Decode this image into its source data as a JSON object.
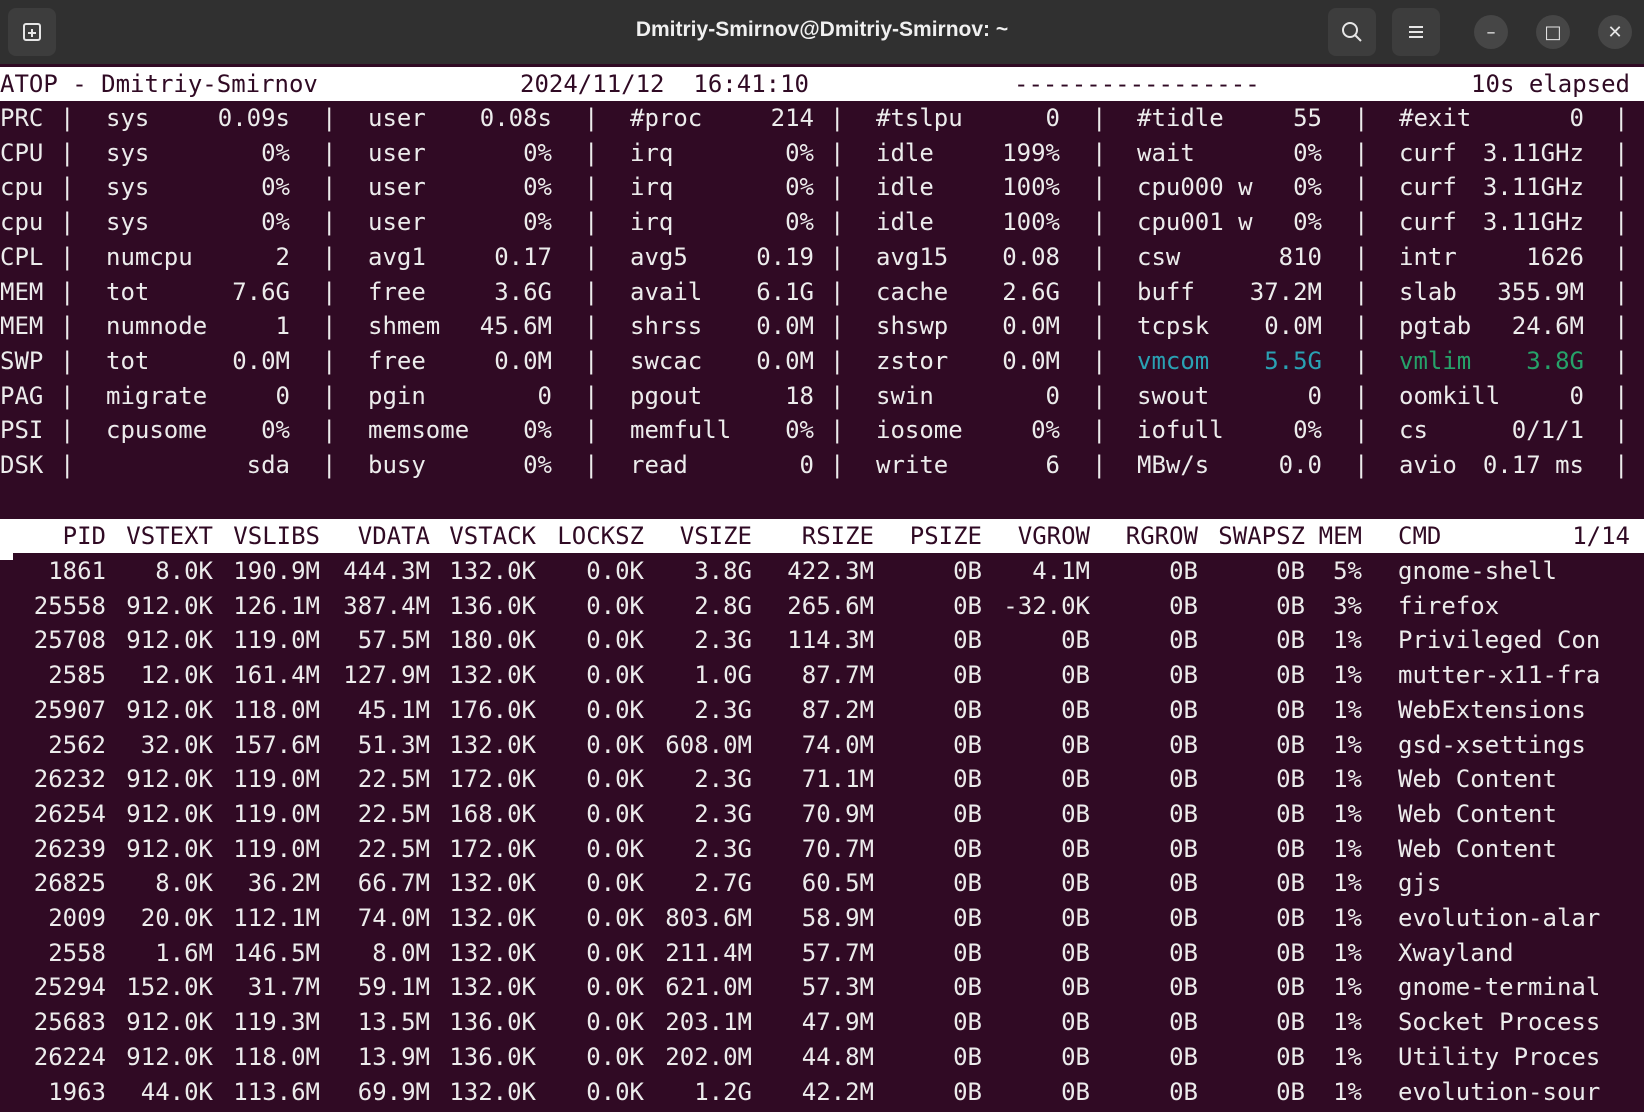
{
  "window": {
    "title": "Dmitriy-Smirnov@Dmitriy-Smirnov: ~",
    "buttons": {
      "minimize": "–",
      "maximize": "□",
      "close": "✕"
    }
  },
  "atop": {
    "header": {
      "program": "ATOP - Dmitriy-Smirnov",
      "datetime": "2024/11/12  16:41:10",
      "flags": "-----------------",
      "elapsed": "10s elapsed"
    },
    "sys_rows": [
      {
        "label": "PRC",
        "cells": [
          [
            "sys",
            "0.09s"
          ],
          [
            "user",
            "0.08s"
          ],
          [
            "#proc",
            "214"
          ],
          [
            "#tslpu",
            "0"
          ],
          [
            "#tidle",
            "55"
          ],
          [
            "#exit",
            "0"
          ]
        ]
      },
      {
        "label": "CPU",
        "cells": [
          [
            "sys",
            "0%"
          ],
          [
            "user",
            "0%"
          ],
          [
            "irq",
            "0%"
          ],
          [
            "idle",
            "199%"
          ],
          [
            "wait",
            "0%"
          ],
          [
            "curf",
            "3.11GHz"
          ]
        ]
      },
      {
        "label": "cpu",
        "cells": [
          [
            "sys",
            "0%"
          ],
          [
            "user",
            "0%"
          ],
          [
            "irq",
            "0%"
          ],
          [
            "idle",
            "100%"
          ],
          [
            "cpu000 w",
            "0%"
          ],
          [
            "curf",
            "3.11GHz"
          ]
        ]
      },
      {
        "label": "cpu",
        "cells": [
          [
            "sys",
            "0%"
          ],
          [
            "user",
            "0%"
          ],
          [
            "irq",
            "0%"
          ],
          [
            "idle",
            "100%"
          ],
          [
            "cpu001 w",
            "0%"
          ],
          [
            "curf",
            "3.11GHz"
          ]
        ]
      },
      {
        "label": "CPL",
        "cells": [
          [
            "numcpu",
            "2"
          ],
          [
            "avg1",
            "0.17"
          ],
          [
            "avg5",
            "0.19"
          ],
          [
            "avg15",
            "0.08"
          ],
          [
            "csw",
            "810"
          ],
          [
            "intr",
            "1626"
          ]
        ]
      },
      {
        "label": "MEM",
        "cells": [
          [
            "tot",
            "7.6G"
          ],
          [
            "free",
            "3.6G"
          ],
          [
            "avail",
            "6.1G"
          ],
          [
            "cache",
            "2.6G"
          ],
          [
            "buff",
            "37.2M"
          ],
          [
            "slab",
            "355.9M"
          ]
        ]
      },
      {
        "label": "MEM",
        "cells": [
          [
            "numnode",
            "1"
          ],
          [
            "shmem",
            "45.6M"
          ],
          [
            "shrss",
            "0.0M"
          ],
          [
            "shswp",
            "0.0M"
          ],
          [
            "tcpsk",
            "0.0M"
          ],
          [
            "pgtab",
            "24.6M"
          ]
        ]
      },
      {
        "label": "SWP",
        "cells": [
          [
            "tot",
            "0.0M"
          ],
          [
            "free",
            "0.0M"
          ],
          [
            "swcac",
            "0.0M"
          ],
          [
            "zstor",
            "0.0M"
          ],
          [
            "vmcom",
            "5.5G"
          ],
          [
            "vmlim",
            "3.8G"
          ]
        ]
      },
      {
        "label": "PAG",
        "cells": [
          [
            "migrate",
            "0"
          ],
          [
            "pgin",
            "0"
          ],
          [
            "pgout",
            "18"
          ],
          [
            "swin",
            "0"
          ],
          [
            "swout",
            "0"
          ],
          [
            "oomkill",
            "0"
          ]
        ]
      },
      {
        "label": "PSI",
        "cells": [
          [
            "cpusome",
            "0%"
          ],
          [
            "memsome",
            "0%"
          ],
          [
            "memfull",
            "0%"
          ],
          [
            "iosome",
            "0%"
          ],
          [
            "iofull",
            "0%"
          ],
          [
            "cs",
            "0/1/1"
          ]
        ]
      },
      {
        "label": "DSK",
        "cells": [
          [
            "",
            "sda"
          ],
          [
            "busy",
            "0%"
          ],
          [
            "read",
            "0"
          ],
          [
            "write",
            "6"
          ],
          [
            "MBw/s",
            "0.0"
          ],
          [
            "avio",
            "0.17 ms"
          ]
        ]
      }
    ],
    "highlight_colors": {
      "vmcom": "#2aa1b3",
      "vmlim": "#26a269"
    },
    "columns": [
      "PID",
      "VSTEXT",
      "VSLIBS",
      "VDATA",
      "VSTACK",
      "LOCKSZ",
      "VSIZE",
      "RSIZE",
      "PSIZE",
      "VGROW",
      "RGROW",
      "SWAPSZ",
      "MEM",
      "CMD"
    ],
    "page": "1/14",
    "processes": [
      [
        "1861",
        "8.0K",
        "190.9M",
        "444.3M",
        "132.0K",
        "0.0K",
        "3.8G",
        "422.3M",
        "0B",
        "4.1M",
        "0B",
        "0B",
        "5%",
        "gnome-shell"
      ],
      [
        "25558",
        "912.0K",
        "126.1M",
        "387.4M",
        "136.0K",
        "0.0K",
        "2.8G",
        "265.6M",
        "0B",
        "-32.0K",
        "0B",
        "0B",
        "3%",
        "firefox"
      ],
      [
        "25708",
        "912.0K",
        "119.0M",
        "57.5M",
        "180.0K",
        "0.0K",
        "2.3G",
        "114.3M",
        "0B",
        "0B",
        "0B",
        "0B",
        "1%",
        "Privileged Con"
      ],
      [
        "2585",
        "12.0K",
        "161.4M",
        "127.9M",
        "132.0K",
        "0.0K",
        "1.0G",
        "87.7M",
        "0B",
        "0B",
        "0B",
        "0B",
        "1%",
        "mutter-x11-fra"
      ],
      [
        "25907",
        "912.0K",
        "118.0M",
        "45.1M",
        "176.0K",
        "0.0K",
        "2.3G",
        "87.2M",
        "0B",
        "0B",
        "0B",
        "0B",
        "1%",
        "WebExtensions"
      ],
      [
        "2562",
        "32.0K",
        "157.6M",
        "51.3M",
        "132.0K",
        "0.0K",
        "608.0M",
        "74.0M",
        "0B",
        "0B",
        "0B",
        "0B",
        "1%",
        "gsd-xsettings"
      ],
      [
        "26232",
        "912.0K",
        "119.0M",
        "22.5M",
        "172.0K",
        "0.0K",
        "2.3G",
        "71.1M",
        "0B",
        "0B",
        "0B",
        "0B",
        "1%",
        "Web Content"
      ],
      [
        "26254",
        "912.0K",
        "119.0M",
        "22.5M",
        "168.0K",
        "0.0K",
        "2.3G",
        "70.9M",
        "0B",
        "0B",
        "0B",
        "0B",
        "1%",
        "Web Content"
      ],
      [
        "26239",
        "912.0K",
        "119.0M",
        "22.5M",
        "172.0K",
        "0.0K",
        "2.3G",
        "70.7M",
        "0B",
        "0B",
        "0B",
        "0B",
        "1%",
        "Web Content"
      ],
      [
        "26825",
        "8.0K",
        "36.2M",
        "66.7M",
        "132.0K",
        "0.0K",
        "2.7G",
        "60.5M",
        "0B",
        "0B",
        "0B",
        "0B",
        "1%",
        "gjs"
      ],
      [
        "2009",
        "20.0K",
        "112.1M",
        "74.0M",
        "132.0K",
        "0.0K",
        "803.6M",
        "58.9M",
        "0B",
        "0B",
        "0B",
        "0B",
        "1%",
        "evolution-alar"
      ],
      [
        "2558",
        "1.6M",
        "146.5M",
        "8.0M",
        "132.0K",
        "0.0K",
        "211.4M",
        "57.7M",
        "0B",
        "0B",
        "0B",
        "0B",
        "1%",
        "Xwayland"
      ],
      [
        "25294",
        "152.0K",
        "31.7M",
        "59.1M",
        "132.0K",
        "0.0K",
        "621.0M",
        "57.3M",
        "0B",
        "0B",
        "0B",
        "0B",
        "1%",
        "gnome-terminal"
      ],
      [
        "25683",
        "912.0K",
        "119.3M",
        "13.5M",
        "136.0K",
        "0.0K",
        "203.1M",
        "47.9M",
        "0B",
        "0B",
        "0B",
        "0B",
        "1%",
        "Socket Process"
      ],
      [
        "26224",
        "912.0K",
        "118.0M",
        "13.9M",
        "136.0K",
        "0.0K",
        "202.0M",
        "44.8M",
        "0B",
        "0B",
        "0B",
        "0B",
        "1%",
        "Utility Proces"
      ],
      [
        "1963",
        "44.0K",
        "113.6M",
        "69.9M",
        "132.0K",
        "0.0K",
        "1.2G",
        "42.2M",
        "0B",
        "0B",
        "0B",
        "0B",
        "1%",
        "evolution-sour"
      ]
    ]
  }
}
